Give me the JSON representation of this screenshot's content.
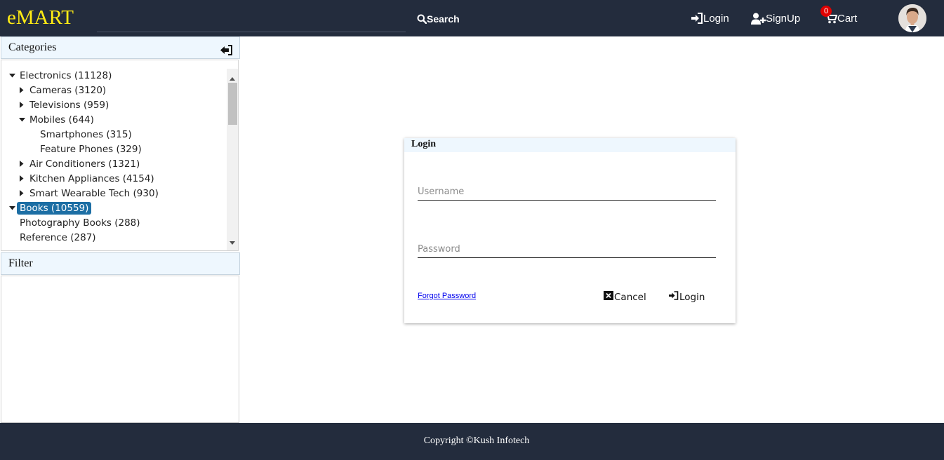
{
  "header": {
    "brand": "eMART",
    "search_label": "Search",
    "login_label": "Login",
    "signup_label": "SignUp",
    "cart_label": "Cart",
    "cart_count": "0",
    "brand_color": "#ffec14",
    "bg_color": "#232c3d"
  },
  "sidebar": {
    "categories_title": "Categories",
    "filter_title": "Filter",
    "tree": [
      {
        "label": "Electronics (11128)",
        "level": 0,
        "state": "expanded"
      },
      {
        "label": "Cameras (3120)",
        "level": 1,
        "state": "collapsed"
      },
      {
        "label": "Televisions (959)",
        "level": 1,
        "state": "collapsed"
      },
      {
        "label": "Mobiles (644)",
        "level": 1,
        "state": "expanded"
      },
      {
        "label": "Smartphones (315)",
        "level": 2,
        "state": "leaf"
      },
      {
        "label": "Feature Phones (329)",
        "level": 2,
        "state": "leaf"
      },
      {
        "label": "Air Conditioners (1321)",
        "level": 1,
        "state": "collapsed"
      },
      {
        "label": "Kitchen Appliances (4154)",
        "level": 1,
        "state": "collapsed"
      },
      {
        "label": "Smart Wearable Tech (930)",
        "level": 1,
        "state": "collapsed"
      },
      {
        "label": "Books (10559)",
        "level": 0,
        "state": "expanded",
        "selected": true
      },
      {
        "label": "Photography Books (288)",
        "level": 1,
        "state": "leaf"
      },
      {
        "label": "Reference (287)",
        "level": 1,
        "state": "leaf"
      }
    ],
    "selected_color": "#1c6ea4"
  },
  "login": {
    "title": "Login",
    "username_placeholder": "Username",
    "password_placeholder": "Password",
    "forgot_label": "Forgot Password",
    "cancel_label": "Cancel",
    "login_label": "Login"
  },
  "footer": {
    "copyright": "Copyright ©Kush Infotech"
  }
}
